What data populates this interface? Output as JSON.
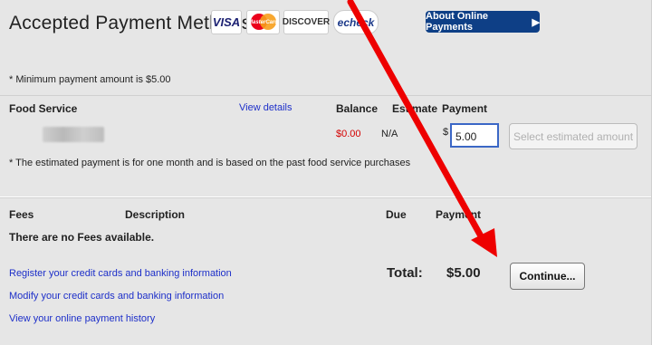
{
  "header": {
    "title": "Accepted Payment Methods",
    "logos": {
      "visa": "VISA",
      "mastercard": "MasterCard",
      "discover": "DISCOVER",
      "echeck": "echeck"
    },
    "about_button": "About Online Payments"
  },
  "notes": {
    "minimum": "* Minimum payment amount is $5.00",
    "estimated": "* The estimated payment is for one month and is based on the past food service purchases"
  },
  "food_service": {
    "headers": {
      "name": "Food Service",
      "details": "View details",
      "balance": "Balance",
      "estimate": "Estimate",
      "payment": "Payment"
    },
    "row": {
      "balance": "$0.00",
      "estimate": "N/A",
      "currency": "$",
      "payment_value": "5.00"
    },
    "select_estimated": "Select estimated amount"
  },
  "fees": {
    "headers": {
      "fees": "Fees",
      "description": "Description",
      "due": "Due",
      "payment": "Payment"
    },
    "empty": "There are no Fees available."
  },
  "links": {
    "register": "Register your credit cards and banking information",
    "modify": "Modify your credit cards and banking information",
    "history": "View your online payment history"
  },
  "totals": {
    "label": "Total:",
    "amount": "$5.00",
    "continue": "Continue..."
  },
  "annotation": {
    "arrow_color": "#ee0000"
  }
}
